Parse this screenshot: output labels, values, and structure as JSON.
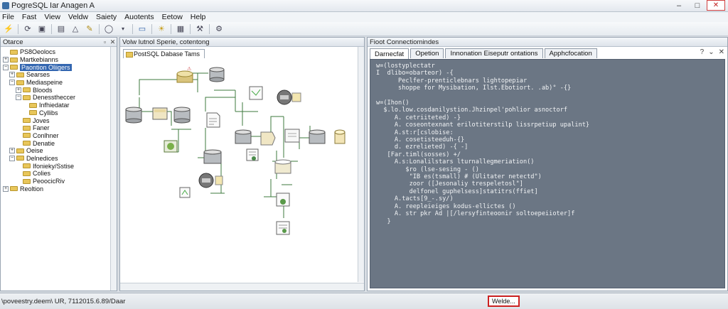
{
  "window": {
    "title": "PogreSQL Iar Anagen A",
    "min": "–",
    "max": "□",
    "close": "✕"
  },
  "menu": [
    "File",
    "Fast",
    "View",
    "Veldw",
    "Saiety",
    "Auotents",
    "Eetow",
    "Help"
  ],
  "object_panel": {
    "title": "Otarce",
    "items": [
      {
        "label": "PS8Oeolocs",
        "indent": 0,
        "exp": ""
      },
      {
        "label": "Martkebianns",
        "indent": 0,
        "exp": "+"
      },
      {
        "label": "Paontion Oliigers",
        "indent": 0,
        "exp": "−",
        "selected": true
      },
      {
        "label": "Searses",
        "indent": 1,
        "exp": "+"
      },
      {
        "label": "Mediaspeine",
        "indent": 1,
        "exp": "−"
      },
      {
        "label": "Bloods",
        "indent": 2,
        "exp": "+"
      },
      {
        "label": "Denesstheccer",
        "indent": 2,
        "exp": "−"
      },
      {
        "label": "Infhiedatar",
        "indent": 3,
        "exp": ""
      },
      {
        "label": "Cyllibs",
        "indent": 3,
        "exp": ""
      },
      {
        "label": "Joves",
        "indent": 2,
        "exp": ""
      },
      {
        "label": "Faner",
        "indent": 2,
        "exp": ""
      },
      {
        "label": "Conlhner",
        "indent": 2,
        "exp": ""
      },
      {
        "label": "Denatie",
        "indent": 2,
        "exp": ""
      },
      {
        "label": "Oeise",
        "indent": 1,
        "exp": "+"
      },
      {
        "label": "Delnedices",
        "indent": 1,
        "exp": "−"
      },
      {
        "label": "Ifonieky/Sstise",
        "indent": 2,
        "exp": ""
      },
      {
        "label": "Colies",
        "indent": 2,
        "exp": ""
      },
      {
        "label": "PeoocicRiv",
        "indent": 2,
        "exp": ""
      },
      {
        "label": "Reoltion",
        "indent": 0,
        "exp": "+"
      }
    ]
  },
  "diagram_panel": {
    "title": "Volw lutnol Sperie, cotentong",
    "tab": "PostSQL Dabase Tams"
  },
  "sql_panel": {
    "title": "Fioot Connectiomindes",
    "tabs": [
      "Darnecfat",
      "Opetion",
      "Innonation Eiseputr ontations",
      "Apphcfocation"
    ],
    "lines": [
      "w=(lostyplectatr",
      "I  dlibo=obarteor) -{",
      "      Peclfer-prenticlebnars lightopepiar",
      "      shoppe for Mysibation, Ilst.Ebotiort. .ab)° -{}",
      "",
      "w=(Ihon()",
      "  $.lo.low.cosdanilystion.Jhzinpel'pohlior asnoctorf",
      "     A. cetriiteted) -}",
      "     A. coseontexnant erilotiterstilp lissrpetiup upalint}",
      "     A.st:r[cslobise:",
      "     A. cosetisteeduh-{}",
      "     d. ezrelieted) -{ -]",
      "   [Far.timl(sosses) +/",
      "     A.s:Lonalilstars lturnallegmeriation()",
      "        $ro (lse-sesing - ()",
      "         \"IB es(tsmall) # (Ulitater netectd\")",
      "         zoor ([Jesonaliy trespeletosl\"]",
      "         delfonel guphelsess]statitrs(ffiet]",
      "     A.tacts[9_-.sy/)",
      "     A. reepleieiges kodus-ellictes ()",
      "     A. str pkr Ad |[/lersyfinteoonir soltoepeiioter]f",
      "   }"
    ]
  },
  "status": {
    "left": "\\poveestry.deem\\ UR, 7112015.6.89/Daar",
    "badge": "Welde..."
  }
}
